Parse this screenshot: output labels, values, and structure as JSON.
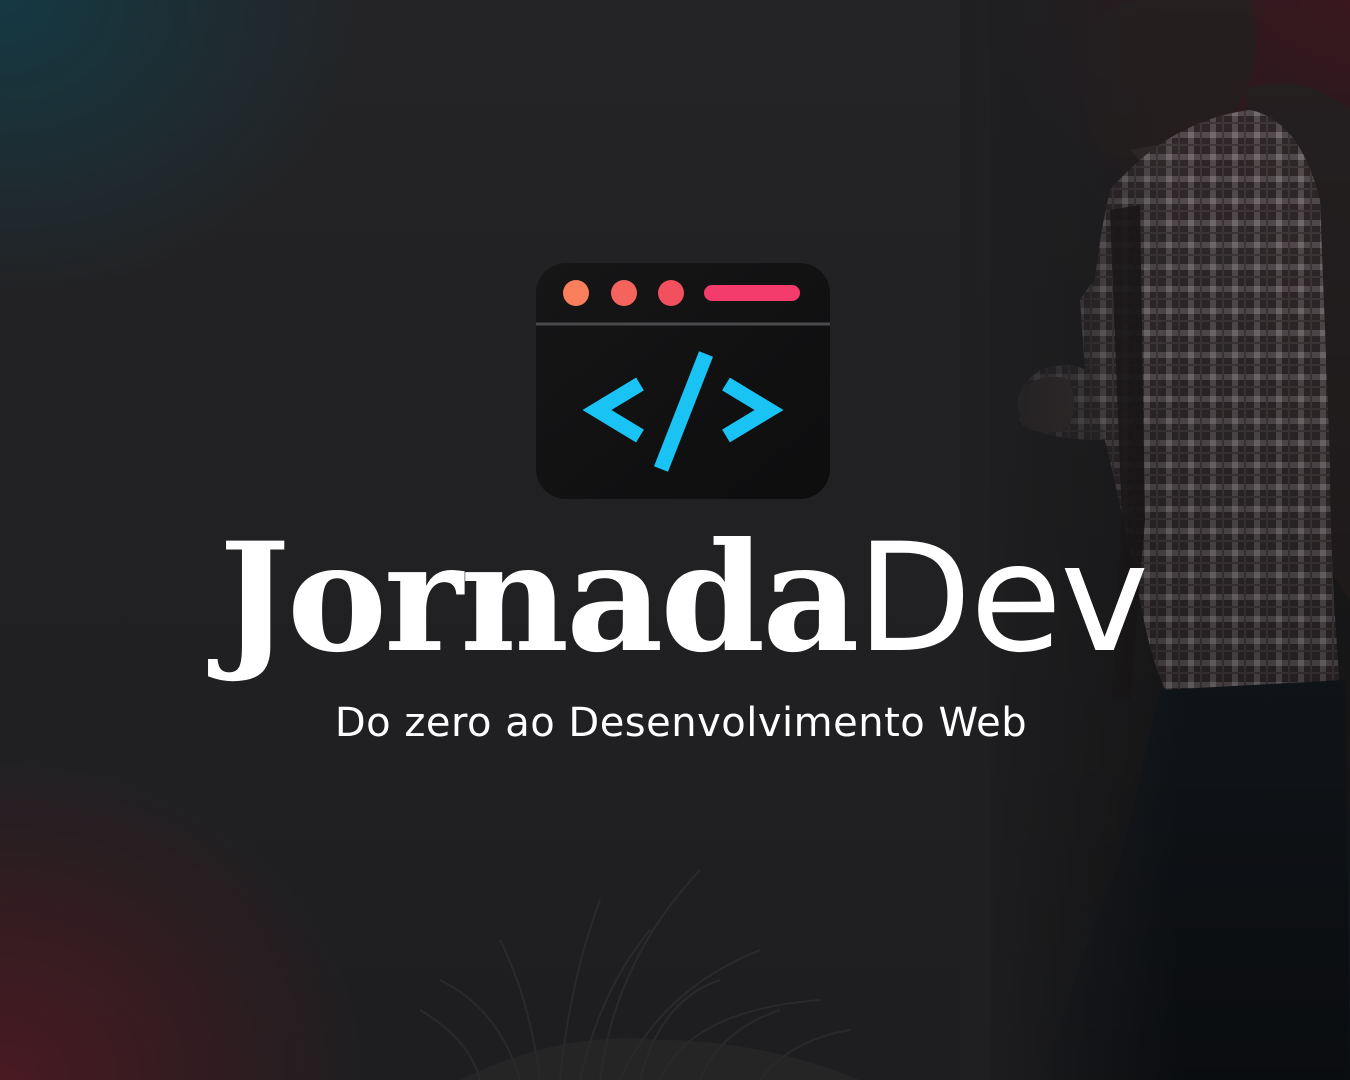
{
  "brand": {
    "name_bold": "Jornada",
    "name_light": "Dev",
    "tagline": "Do zero ao Desenvolvimento Web"
  },
  "logo": {
    "icon": "code-window-icon",
    "code_symbol": "</>",
    "dot_colors": [
      "#f97f5c",
      "#f5645c",
      "#f2505f"
    ],
    "bar_color": "#f43c6c",
    "code_color": "#19c4f5"
  },
  "background": {
    "subject": "hiker-with-backpack",
    "base_color": "#1f1f21",
    "accent_teal": "#123c48",
    "accent_red": "#581822"
  }
}
